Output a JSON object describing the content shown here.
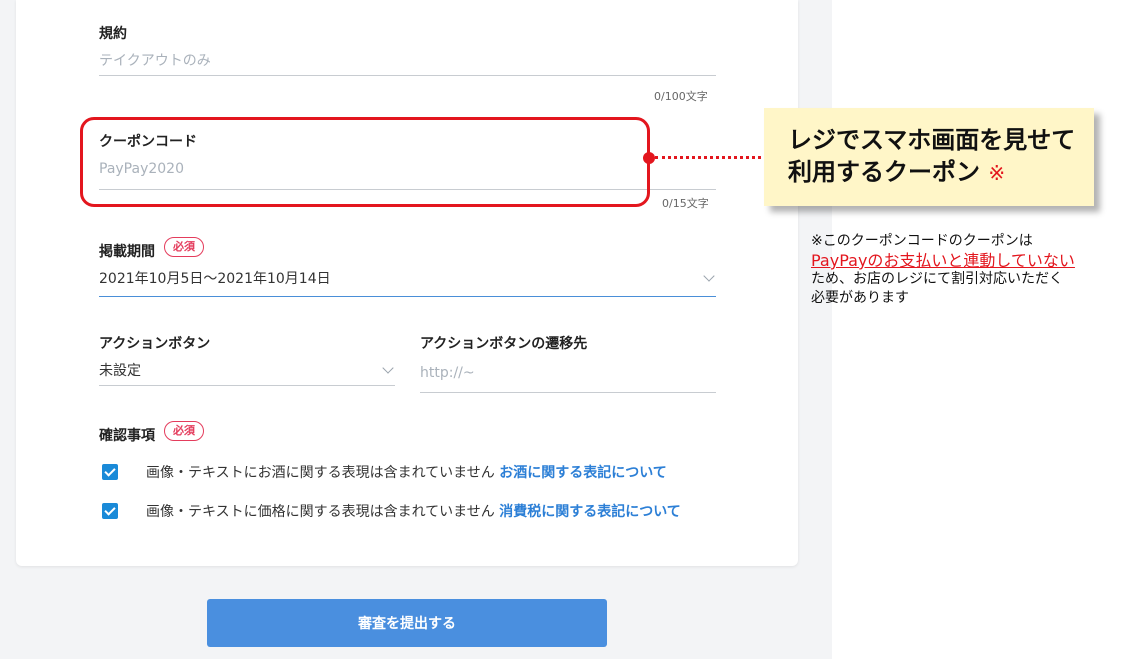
{
  "form": {
    "terms": {
      "label": "規約",
      "placeholder": "テイクアウトのみ",
      "counter": "0/100文字"
    },
    "coupon_code": {
      "label": "クーポンコード",
      "placeholder": "PayPay2020",
      "counter": "0/15文字"
    },
    "period": {
      "label": "掲載期間",
      "required": "必須",
      "value": "2021年10月5日～2021年10月14日"
    },
    "action_button": {
      "label": "アクションボタン",
      "value": "未設定"
    },
    "action_target": {
      "label": "アクションボタンの遷移先",
      "placeholder": "http://~"
    },
    "confirm": {
      "label": "確認事項",
      "required": "必須",
      "items": [
        {
          "text": "画像・テキストにお酒に関する表現は含まれていません",
          "link": "お酒に関する表記について",
          "checked": true
        },
        {
          "text": "画像・テキストに価格に関する表現は含まれていません",
          "link": "消費税に関する表記について",
          "checked": true
        }
      ]
    },
    "submit_label": "審査を提出する"
  },
  "annotation": {
    "callout_line1": "レジでスマホ画面を見せて",
    "callout_line2": "利用するクーポン",
    "callout_mark": "※",
    "note_line1": "※このクーポンコードのクーポンは",
    "note_highlight": "PayPayのお支払いと連動していない",
    "note_line2": "ため、お店のレジにて割引対応いただく",
    "note_line3": "必要があります"
  },
  "colors": {
    "accent_blue": "#4a8fdf",
    "link_blue": "#2c7fd6",
    "required_red": "#e43c5c",
    "highlight_red": "#e3161e",
    "callout_bg": "#fff6c8"
  }
}
